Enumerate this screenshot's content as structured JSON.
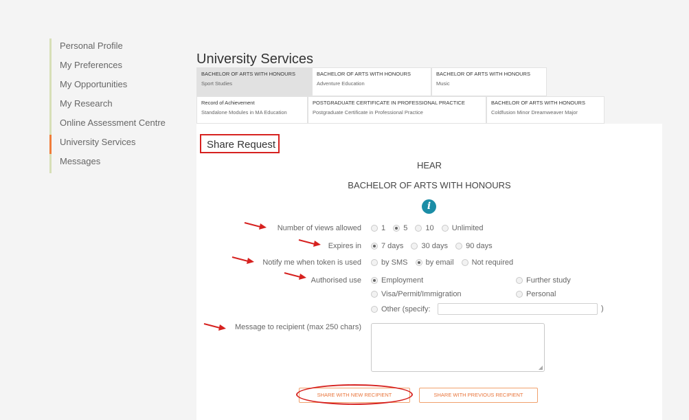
{
  "sidebar": {
    "items": [
      {
        "label": "Personal Profile"
      },
      {
        "label": "My Preferences"
      },
      {
        "label": "My Opportunities"
      },
      {
        "label": "My Research"
      },
      {
        "label": "Online Assessment Centre"
      },
      {
        "label": "University Services",
        "active": true
      },
      {
        "label": "Messages"
      }
    ]
  },
  "page_title": "University Services",
  "tabs": [
    {
      "title": "BACHELOR OF ARTS WITH HONOURS",
      "subtitle": "Sport Studies",
      "active": true
    },
    {
      "title": "BACHELOR OF ARTS WITH HONOURS",
      "subtitle": "Adventure Education"
    },
    {
      "title": "BACHELOR OF ARTS WITH HONOURS",
      "subtitle": "Music"
    },
    {
      "title": "Record of Achievement",
      "subtitle": "Standalone Modules in MA Education"
    },
    {
      "title": "POSTGRADUATE CERTIFICATE IN PROFESSIONAL PRACTICE",
      "subtitle": "Postgraduate Certificate in Professional Practice"
    },
    {
      "title": "BACHELOR OF ARTS WITH HONOURS",
      "subtitle": "Coldfusion Minor Dreamweaver Major"
    }
  ],
  "share": {
    "title": "Share Request",
    "hear": "HEAR",
    "degree": "BACHELOR OF ARTS WITH HONOURS",
    "info_icon": "info-icon"
  },
  "form": {
    "views": {
      "label": "Number of views allowed",
      "options": [
        "1",
        "5",
        "10",
        "Unlimited"
      ],
      "selected": "5"
    },
    "expires": {
      "label": "Expires in",
      "options": [
        "7 days",
        "30 days",
        "90 days"
      ],
      "selected": "7 days"
    },
    "notify": {
      "label": "Notify me when token is used",
      "options": [
        "by SMS",
        "by email",
        "Not required"
      ],
      "selected": "by email"
    },
    "use": {
      "label": "Authorised use",
      "options": [
        "Employment",
        "Further study",
        "Visa/Permit/Immigration",
        "Personal",
        "Other (specify:"
      ],
      "selected": "Employment",
      "close_paren": ")"
    },
    "message": {
      "label": "Message to recipient (max 250 chars)",
      "value": ""
    }
  },
  "buttons": {
    "new_recipient": "Share with new recipient",
    "previous_recipient": "Share with previous recipient"
  },
  "colors": {
    "annotation_red": "#d6211f",
    "accent_orange": "#e8743a",
    "info_blue": "#1b8da6"
  }
}
